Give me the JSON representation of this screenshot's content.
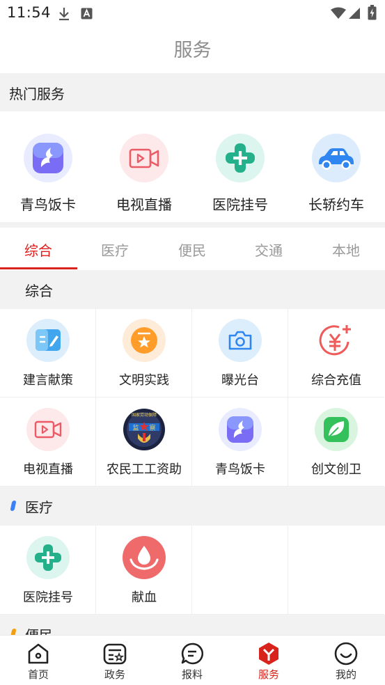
{
  "status_bar": {
    "time": "11:54"
  },
  "header": {
    "title": "服务"
  },
  "hot_services": {
    "title": "热门服务",
    "items": [
      {
        "label": "青鸟饭卡",
        "icon": "qingniao-card-icon"
      },
      {
        "label": "电视直播",
        "icon": "tv-live-icon"
      },
      {
        "label": "医院挂号",
        "icon": "hospital-icon"
      },
      {
        "label": "长轿约车",
        "icon": "car-icon"
      }
    ]
  },
  "tabs": {
    "items": [
      "综合",
      "医疗",
      "便民",
      "交通",
      "本地"
    ],
    "active": "综合"
  },
  "categories": {
    "general": {
      "title": "综合",
      "items": [
        {
          "label": "建言献策",
          "icon": "suggestion-icon"
        },
        {
          "label": "文明实践",
          "icon": "civilization-star-icon"
        },
        {
          "label": "曝光台",
          "icon": "camera-icon"
        },
        {
          "label": "综合充值",
          "icon": "yuan-recharge-icon"
        },
        {
          "label": "电视直播",
          "icon": "tv-live-icon"
        },
        {
          "label": "农民工工资助",
          "icon": "labor-supervision-badge"
        },
        {
          "label": "青鸟饭卡",
          "icon": "qingniao-card-icon"
        },
        {
          "label": "创文创卫",
          "icon": "leaf-icon"
        }
      ],
      "badge_text": {
        "top": "国家劳动保障",
        "left": "监",
        "right": "察"
      }
    },
    "medical": {
      "title": "医疗",
      "items": [
        {
          "label": "医院挂号",
          "icon": "hospital-icon"
        },
        {
          "label": "献血",
          "icon": "blood-donation-icon"
        }
      ]
    },
    "convenience": {
      "title": "便民"
    }
  },
  "bottom_nav": {
    "items": [
      {
        "label": "首页",
        "icon": "home-icon"
      },
      {
        "label": "政务",
        "icon": "government-icon"
      },
      {
        "label": "报料",
        "icon": "report-chat-icon"
      },
      {
        "label": "服务",
        "icon": "service-icon"
      },
      {
        "label": "我的",
        "icon": "profile-icon"
      }
    ],
    "active": "服务"
  },
  "colors": {
    "accent_red": "#d8231c",
    "section_bg": "#f2f2f2",
    "medical_marker": "#3b82f6",
    "convenience_marker": "#f59e0b"
  }
}
